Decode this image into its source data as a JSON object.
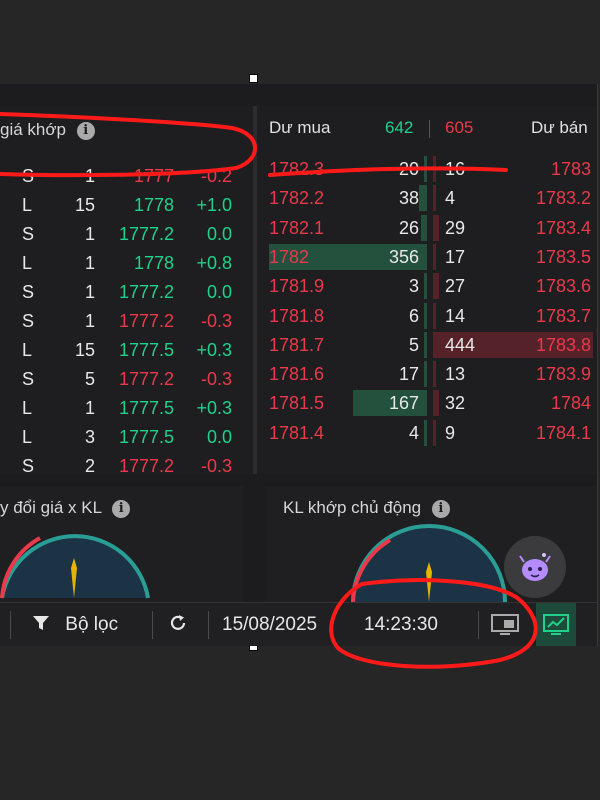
{
  "trades": {
    "header_label": "giá khớp",
    "rows": [
      {
        "side": "S",
        "qty": "1",
        "price": "1777",
        "change": "-0.2",
        "dir": "red"
      },
      {
        "side": "L",
        "qty": "15",
        "price": "1778",
        "change": "+1.0",
        "dir": "green"
      },
      {
        "side": "S",
        "qty": "1",
        "price": "1777.2",
        "change": "0.0",
        "dir": "green"
      },
      {
        "side": "L",
        "qty": "1",
        "price": "1778",
        "change": "+0.8",
        "dir": "green"
      },
      {
        "side": "S",
        "qty": "1",
        "price": "1777.2",
        "change": "0.0",
        "dir": "green"
      },
      {
        "side": "S",
        "qty": "1",
        "price": "1777.2",
        "change": "-0.3",
        "dir": "red"
      },
      {
        "side": "L",
        "qty": "15",
        "price": "1777.5",
        "change": "+0.3",
        "dir": "green"
      },
      {
        "side": "S",
        "qty": "5",
        "price": "1777.2",
        "change": "-0.3",
        "dir": "red"
      },
      {
        "side": "L",
        "qty": "1",
        "price": "1777.5",
        "change": "+0.3",
        "dir": "green"
      },
      {
        "side": "L",
        "qty": "3",
        "price": "1777.5",
        "change": "0.0",
        "dir": "green"
      },
      {
        "side": "S",
        "qty": "2",
        "price": "1777.2",
        "change": "-0.3",
        "dir": "red"
      }
    ]
  },
  "book": {
    "bid_label": "Dư mua",
    "bid_total": "642",
    "ask_total": "605",
    "ask_label": "Dư bán",
    "rows": [
      {
        "bid_price": "1782.3",
        "bid_vol": "20",
        "bid_level": 0.02,
        "ask_vol": "16",
        "ask_level": 0.02,
        "ask_price": "1783"
      },
      {
        "bid_price": "1782.2",
        "bid_vol": "38",
        "bid_level": 0.05,
        "ask_vol": "4",
        "ask_level": 0.01,
        "ask_price": "1783.2"
      },
      {
        "bid_price": "1782.1",
        "bid_vol": "26",
        "bid_level": 0.04,
        "ask_vol": "29",
        "ask_level": 0.04,
        "ask_price": "1783.4"
      },
      {
        "bid_price": "1782",
        "bid_vol": "356",
        "bid_level": 1.0,
        "ask_vol": "17",
        "ask_level": 0.02,
        "ask_price": "1783.5"
      },
      {
        "bid_price": "1781.9",
        "bid_vol": "3",
        "bid_level": 0.01,
        "ask_vol": "27",
        "ask_level": 0.04,
        "ask_price": "1783.6"
      },
      {
        "bid_price": "1781.8",
        "bid_vol": "6",
        "bid_level": 0.01,
        "ask_vol": "14",
        "ask_level": 0.02,
        "ask_price": "1783.7"
      },
      {
        "bid_price": "1781.7",
        "bid_vol": "5",
        "bid_level": 0.01,
        "ask_vol": "444",
        "ask_level": 1.0,
        "ask_price": "1783.8"
      },
      {
        "bid_price": "1781.6",
        "bid_vol": "17",
        "bid_level": 0.02,
        "ask_vol": "13",
        "ask_level": 0.02,
        "ask_price": "1783.9"
      },
      {
        "bid_price": "1781.5",
        "bid_vol": "167",
        "bid_level": 0.47,
        "ask_vol": "32",
        "ask_level": 0.04,
        "ask_price": "1784"
      },
      {
        "bid_price": "1781.4",
        "bid_vol": "4",
        "bid_level": 0.01,
        "ask_vol": "9",
        "ask_level": 0.01,
        "ask_price": "1784.1"
      }
    ]
  },
  "gauges": {
    "left_title": "y đổi giá x KL",
    "right_title": "KL khớp chủ động"
  },
  "toolbar": {
    "filter_label": "Bộ lọc",
    "date": "15/08/2025",
    "time": "14:23:30"
  },
  "icons": {
    "info": "info-icon",
    "filter": "filter-icon",
    "refresh": "refresh-icon",
    "layout": "layout-icon",
    "chart_layout": "chart-layout-icon",
    "assistant": "assistant-bot-icon"
  },
  "colors": {
    "up": "#20d18b",
    "down": "#e9394a",
    "annotation": "#ff1a1a",
    "bid_bar": "#23513e",
    "ask_bar": "#55222a"
  }
}
